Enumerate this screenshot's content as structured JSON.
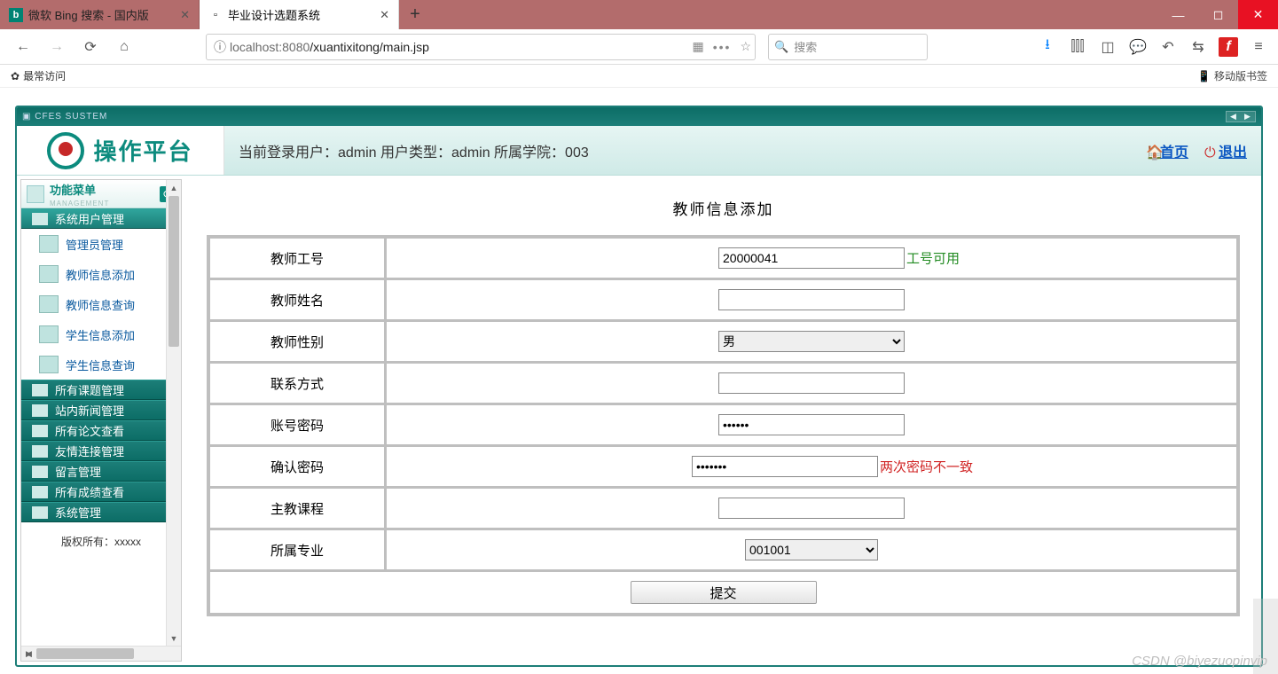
{
  "browser": {
    "tabs": [
      {
        "title": "微软 Bing 搜索 - 国内版",
        "active": false
      },
      {
        "title": "毕业设计选题系统",
        "active": true
      }
    ],
    "url_host": "localhost:8080",
    "url_path": "/xuantixitong/main.jsp",
    "search_placeholder": "搜索",
    "most_visited_label": "最常访问",
    "mobile_bookmarks_label": "移动版书签"
  },
  "app": {
    "window_title": "CFES SUSTEM",
    "logo_text": "操作平台",
    "userbar": "当前登录用户：admin   用户类型：admin   所属学院：003",
    "home_link": "首页",
    "logout_link": "退出"
  },
  "menu": {
    "header_title": "功能菜单",
    "header_sub": "MANAGEMENT",
    "nodes": [
      {
        "type": "cat",
        "label": "系统用户管理",
        "active": true
      },
      {
        "type": "leaf",
        "label": "管理员管理"
      },
      {
        "type": "leaf",
        "label": "教师信息添加"
      },
      {
        "type": "leaf",
        "label": "教师信息查询"
      },
      {
        "type": "leaf",
        "label": "学生信息添加"
      },
      {
        "type": "leaf",
        "label": "学生信息查询"
      },
      {
        "type": "cat",
        "label": "所有课题管理"
      },
      {
        "type": "cat",
        "label": "站内新闻管理"
      },
      {
        "type": "cat",
        "label": "所有论文查看"
      },
      {
        "type": "cat",
        "label": "友情连接管理"
      },
      {
        "type": "cat",
        "label": "留言管理"
      },
      {
        "type": "cat",
        "label": "所有成绩查看"
      },
      {
        "type": "cat",
        "label": "系统管理"
      }
    ],
    "footer": "版权所有：xxxxx"
  },
  "form": {
    "title": "教师信息添加",
    "rows": {
      "teacher_id": {
        "label": "教师工号",
        "value": "20000041",
        "hint": "工号可用"
      },
      "teacher_name": {
        "label": "教师姓名",
        "value": ""
      },
      "gender": {
        "label": "教师性别",
        "value": "男"
      },
      "contact": {
        "label": "联系方式",
        "value": ""
      },
      "password": {
        "label": "账号密码",
        "value": "••••••"
      },
      "password2": {
        "label": "确认密码",
        "value": "•••••••",
        "hint": "两次密码不一致"
      },
      "course": {
        "label": "主教课程",
        "value": ""
      },
      "major": {
        "label": "所属专业",
        "value": "001001"
      }
    },
    "submit_label": "提交"
  },
  "watermark": "CSDN @biyezuopinvip"
}
